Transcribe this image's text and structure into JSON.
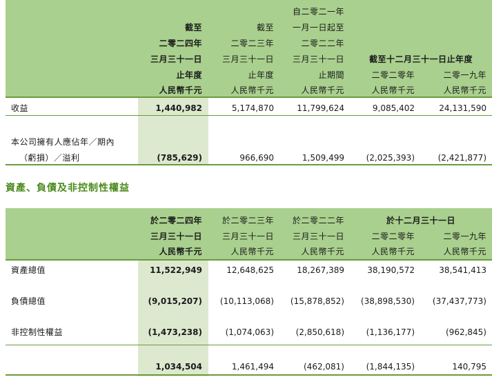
{
  "table1": {
    "columns": [
      {
        "lines": [
          "截至",
          "二零二四年",
          "三月三十一日",
          "止年度",
          "人民幣千元"
        ]
      },
      {
        "lines": [
          "截至",
          "二零二三年",
          "三月三十一日",
          "止年度",
          "人民幣千元"
        ]
      },
      {
        "lines": [
          "自二零二一年",
          "一月一日起至",
          "二零二二年",
          "三月三十一日",
          "止期間",
          "人民幣千元"
        ]
      },
      {
        "lines": [
          "二零二零年",
          "人民幣千元"
        ]
      },
      {
        "lines": [
          "二零一九年",
          "人民幣千元"
        ]
      }
    ],
    "group_header": "截至十二月三十一日止年度",
    "rows": [
      {
        "label": "收益",
        "values": [
          "1,440,982",
          "5,174,870",
          "11,799,624",
          "9,085,402",
          "24,131,590"
        ]
      },
      {
        "label_lines": [
          "本公司擁有人應佔年／期內",
          "（虧損）／溢利"
        ],
        "values": [
          "(785,629)",
          "966,690",
          "1,509,499",
          "(2,025,393)",
          "(2,421,877)"
        ]
      }
    ]
  },
  "section_title": "資產、負債及非控制性權益",
  "table2": {
    "columns": [
      {
        "lines": [
          "於二零二四年",
          "三月三十一日",
          "人民幣千元"
        ]
      },
      {
        "lines": [
          "於二零二三年",
          "三月三十一日",
          "人民幣千元"
        ]
      },
      {
        "lines": [
          "於二零二二年",
          "三月三十一日",
          "人民幣千元"
        ]
      },
      {
        "lines": [
          "二零二零年",
          "人民幣千元"
        ]
      },
      {
        "lines": [
          "二零一九年",
          "人民幣千元"
        ]
      }
    ],
    "group_header": "於十二月三十一日",
    "rows": [
      {
        "label": "資產總值",
        "values": [
          "11,522,949",
          "12,648,625",
          "18,267,389",
          "38,190,572",
          "38,541,413"
        ]
      },
      {
        "label": "負債總值",
        "values": [
          "(9,015,207)",
          "(10,113,068)",
          "(15,878,852)",
          "(38,898,530)",
          "(37,437,773)"
        ]
      },
      {
        "label": "非控制性權益",
        "values": [
          "(1,473,238)",
          "(1,074,063)",
          "(2,850,618)",
          "(1,136,177)",
          "(962,845)"
        ]
      },
      {
        "label": "",
        "values": [
          "1,034,504",
          "1,461,494",
          "(462,081)",
          "(1,844,135)",
          "140,795"
        ]
      }
    ]
  }
}
